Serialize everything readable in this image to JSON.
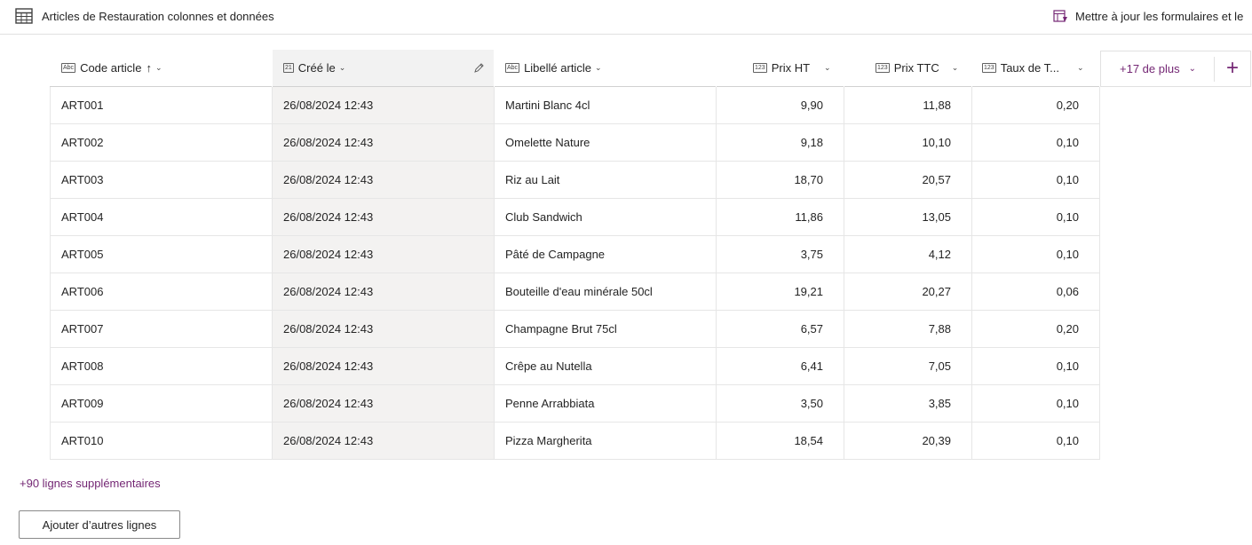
{
  "topbar": {
    "title": "Articles de Restauration colonnes et données",
    "right_action": "Mettre à jour les formulaires et le"
  },
  "columns": [
    {
      "label": "Code article",
      "type_icon": "Abc",
      "sort_arrow": "↑",
      "chevron": "⌄"
    },
    {
      "label": "Créé le",
      "type_icon": "21",
      "chevron": "⌄"
    },
    {
      "label": "Libellé article",
      "type_icon": "Abc",
      "chevron": "⌄"
    },
    {
      "label": "Prix HT",
      "type_icon": "123",
      "chevron": "⌄"
    },
    {
      "label": "Prix TTC",
      "type_icon": "123",
      "chevron": "⌄"
    },
    {
      "label": "Taux de T...",
      "type_icon": "123",
      "chevron": "⌄"
    }
  ],
  "rows": [
    [
      "ART001",
      "26/08/2024 12:43",
      "Martini Blanc 4cl",
      "9,90",
      "11,88",
      "0,20"
    ],
    [
      "ART002",
      "26/08/2024 12:43",
      "Omelette Nature",
      "9,18",
      "10,10",
      "0,10"
    ],
    [
      "ART003",
      "26/08/2024 12:43",
      "Riz au Lait",
      "18,70",
      "20,57",
      "0,10"
    ],
    [
      "ART004",
      "26/08/2024 12:43",
      "Club Sandwich",
      "11,86",
      "13,05",
      "0,10"
    ],
    [
      "ART005",
      "26/08/2024 12:43",
      "Pâté de Campagne",
      "3,75",
      "4,12",
      "0,10"
    ],
    [
      "ART006",
      "26/08/2024 12:43",
      "Bouteille d'eau minérale 50cl",
      "19,21",
      "20,27",
      "0,06"
    ],
    [
      "ART007",
      "26/08/2024 12:43",
      "Champagne Brut 75cl",
      "6,57",
      "7,88",
      "0,20"
    ],
    [
      "ART008",
      "26/08/2024 12:43",
      "Crêpe au Nutella",
      "6,41",
      "7,05",
      "0,10"
    ],
    [
      "ART009",
      "26/08/2024 12:43",
      "Penne Arrabbiata",
      "3,50",
      "3,85",
      "0,10"
    ],
    [
      "ART010",
      "26/08/2024 12:43",
      "Pizza Margherita",
      "18,54",
      "20,39",
      "0,10"
    ]
  ],
  "more_columns": {
    "label": "+17 de plus",
    "chevron": "⌄",
    "add_symbol": "+"
  },
  "more_rows": "+90 lignes supplémentaires",
  "add_rows_button": "Ajouter d’autres lignes",
  "colors": {
    "accent": "#742774",
    "selected_column": "#f3f2f1"
  }
}
